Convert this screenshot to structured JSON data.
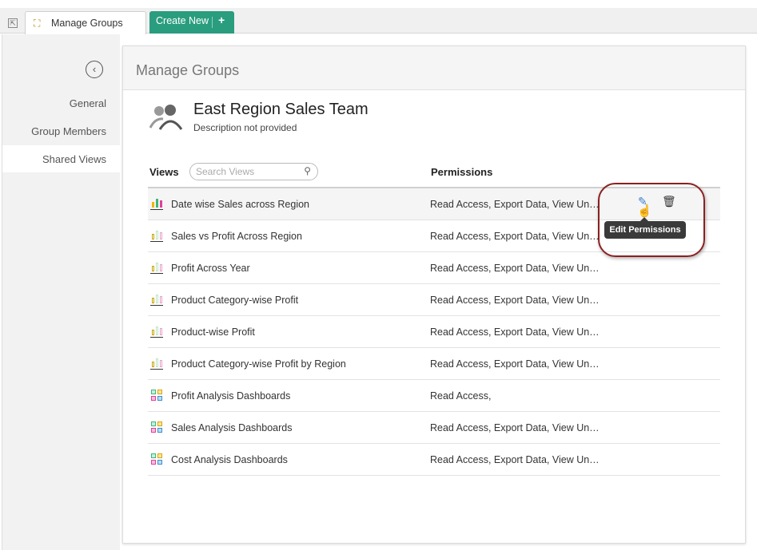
{
  "topbar": {
    "tab_label": "Manage Groups",
    "create_label": "Create New",
    "create_plus": "+"
  },
  "sidebar": {
    "items": [
      {
        "label": "General"
      },
      {
        "label": "Group Members"
      },
      {
        "label": "Shared Views"
      }
    ]
  },
  "panel": {
    "title": "Manage Groups",
    "group_name": "East Region Sales Team",
    "group_desc": "Description not provided"
  },
  "table": {
    "views_header": "Views",
    "search_placeholder": "Search Views",
    "permissions_header": "Permissions",
    "rows": [
      {
        "name": "Date wise Sales across Region",
        "permissions": "Read Access, Export Data, View Un…",
        "icon": "chart-icon"
      },
      {
        "name": "Sales vs Profit Across Region",
        "permissions": "Read Access, Export Data, View Un…",
        "icon": "chart-icon"
      },
      {
        "name": "Profit Across Year",
        "permissions": "Read Access, Export Data, View Un…",
        "icon": "chart-icon"
      },
      {
        "name": "Product Category-wise Profit",
        "permissions": "Read Access, Export Data, View Un…",
        "icon": "chart-icon"
      },
      {
        "name": "Product-wise Profit",
        "permissions": "Read Access, Export Data, View Un…",
        "icon": "chart-icon"
      },
      {
        "name": "Product Category-wise Profit by Region",
        "permissions": "Read Access, Export Data, View Un…",
        "icon": "chart-icon"
      },
      {
        "name": "Profit Analysis Dashboards",
        "permissions": "Read Access,",
        "icon": "dashboard-icon"
      },
      {
        "name": "Sales Analysis Dashboards",
        "permissions": "Read Access, Export Data, View Un…",
        "icon": "dashboard-icon"
      },
      {
        "name": "Cost Analysis Dashboards",
        "permissions": "Read Access, Export Data, View Un…",
        "icon": "dashboard-icon"
      }
    ]
  },
  "tooltip": {
    "label": "Edit Permissions"
  }
}
